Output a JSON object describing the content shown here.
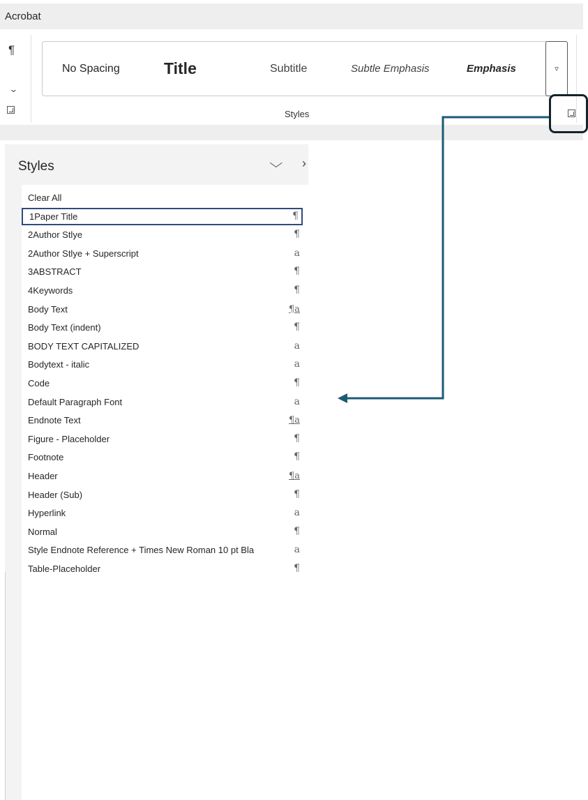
{
  "ribbon": {
    "tab_label": "Acrobat",
    "group_label": "Styles",
    "gallery": [
      {
        "label": "No Spacing"
      },
      {
        "label": "Title"
      },
      {
        "label": "Subtitle"
      },
      {
        "label": "Subtle Emphasis"
      },
      {
        "label": "Emphasis"
      }
    ]
  },
  "pane": {
    "title": "Styles",
    "styles": [
      {
        "name": "Clear All",
        "kind": ""
      },
      {
        "name": "1Paper Title",
        "kind": "¶",
        "selected": true
      },
      {
        "name": "2Author Stlye",
        "kind": "¶"
      },
      {
        "name": "2Author Stlye + Superscript",
        "kind": "a"
      },
      {
        "name": "3ABSTRACT",
        "kind": "¶"
      },
      {
        "name": "4Keywords",
        "kind": "¶"
      },
      {
        "name": "Body Text",
        "kind": "¶a"
      },
      {
        "name": "Body Text (indent)",
        "kind": "¶"
      },
      {
        "name": "BODY TEXT CAPITALIZED",
        "kind": "a"
      },
      {
        "name": "Bodytext - italic",
        "kind": "a"
      },
      {
        "name": "Code",
        "kind": "¶"
      },
      {
        "name": "Default Paragraph Font",
        "kind": "a"
      },
      {
        "name": "Endnote Text",
        "kind": "¶a"
      },
      {
        "name": "Figure - Placeholder",
        "kind": "¶"
      },
      {
        "name": "Footnote",
        "kind": "¶"
      },
      {
        "name": "Header",
        "kind": "¶a"
      },
      {
        "name": "Header (Sub)",
        "kind": "¶"
      },
      {
        "name": "Hyperlink",
        "kind": "a"
      },
      {
        "name": "Normal",
        "kind": "¶"
      },
      {
        "name": "Style Endnote Reference + Times New Roman 10 pt Bla",
        "kind": "a"
      },
      {
        "name": "Table-Placeholder",
        "kind": "¶"
      }
    ]
  },
  "colors": {
    "callout_arrow": "#1d5a74",
    "callout_box": "#14232b",
    "selection_border": "#2f4b7c"
  },
  "icons": {
    "paragraph": "pilcrow-icon",
    "chevron": "chevron-down-icon",
    "launcher": "dialog-launcher-icon",
    "more": "gallery-more-icon",
    "collapse": "chevron-down-icon",
    "next": "chevron-right-icon"
  }
}
